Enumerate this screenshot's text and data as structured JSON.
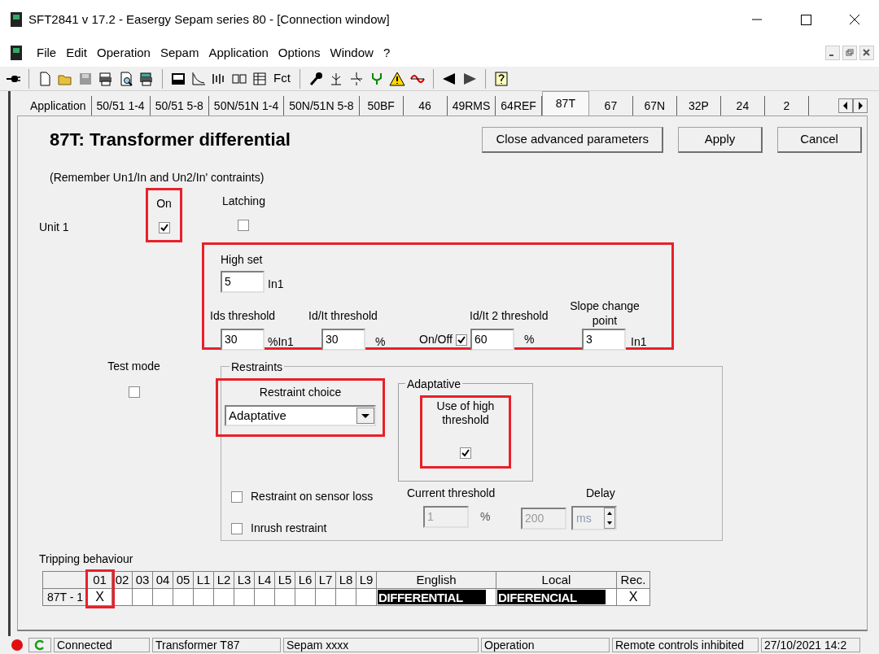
{
  "window": {
    "title": "SFT2841  v 17.2 - Easergy Sepam series 80 - [Connection window]"
  },
  "menu": [
    "File",
    "Edit",
    "Operation",
    "Sepam",
    "Application",
    "Options",
    "Window",
    "?"
  ],
  "toolbar": {
    "fct_label": "Fct"
  },
  "tabs": [
    {
      "label": "Application",
      "selected": false
    },
    {
      "label": "50/51 1-4",
      "selected": false
    },
    {
      "label": "50/51 5-8",
      "selected": false
    },
    {
      "label": "50N/51N 1-4",
      "selected": false
    },
    {
      "label": "50N/51N 5-8",
      "selected": false
    },
    {
      "label": "50BF",
      "selected": false
    },
    {
      "label": "46",
      "selected": false
    },
    {
      "label": "49RMS",
      "selected": false
    },
    {
      "label": "64REF",
      "selected": false
    },
    {
      "label": "87T",
      "selected": true
    },
    {
      "label": "67",
      "selected": false
    },
    {
      "label": "67N",
      "selected": false
    },
    {
      "label": "32P",
      "selected": false
    },
    {
      "label": "24",
      "selected": false
    },
    {
      "label": "2",
      "selected": false
    }
  ],
  "heading": "87T: Transformer differential",
  "buttons": [
    "Close advanced parameters",
    "Apply",
    "Cancel"
  ],
  "note": "(Remember Un1/In and Un2/In' contraints)",
  "unit": {
    "label": "Unit 1",
    "on_label": "On",
    "on": true,
    "on_highlighted": true,
    "latching_label": "Latching",
    "latching": false
  },
  "parameters": {
    "highlighted": true,
    "high_set": {
      "label": "High set",
      "value": "5",
      "unit": "In1"
    },
    "ids": {
      "label": "Ids threshold",
      "value": "30",
      "unit": "%In1"
    },
    "idit": {
      "label": "Id/It threshold",
      "value": "30",
      "unit": "%"
    },
    "idit2": {
      "label": "Id/It 2 threshold",
      "toggle_label": "On/Off",
      "enabled": true,
      "value": "60",
      "unit": "%"
    },
    "slope": {
      "label": "Slope change point",
      "value": "3",
      "unit": "In1"
    }
  },
  "test_mode": {
    "label": "Test mode",
    "checked": false
  },
  "restraints": {
    "title": "Restraints",
    "choice_label": "Restraint choice",
    "choice": "Adaptative",
    "choice_highlighted": true,
    "adaptive": {
      "title": "Adaptative",
      "label": "Use of high threshold",
      "checked": true,
      "highlighted": true
    },
    "sensor_loss": {
      "label": "Restraint on sensor loss",
      "checked": false
    },
    "inrush": {
      "label": "Inrush restraint",
      "checked": false
    },
    "current_threshold": {
      "label": "Current threshold",
      "value": "1",
      "unit": "%",
      "disabled": true
    },
    "delay": {
      "label": "Delay",
      "value": "200",
      "unit": "ms",
      "disabled": true
    }
  },
  "tripping": {
    "title": "Tripping behaviour",
    "columns": [
      {
        "label": "01",
        "highlighted": true
      },
      {
        "label": "02",
        "highlighted": false
      },
      {
        "label": "03",
        "highlighted": false
      },
      {
        "label": "04",
        "highlighted": false
      },
      {
        "label": "05",
        "highlighted": false
      },
      {
        "label": "L1",
        "highlighted": false
      },
      {
        "label": "L2",
        "highlighted": false
      },
      {
        "label": "L3",
        "highlighted": false
      },
      {
        "label": "L4",
        "highlighted": false
      },
      {
        "label": "L5",
        "highlighted": false
      },
      {
        "label": "L6",
        "highlighted": false
      },
      {
        "label": "L7",
        "highlighted": false
      },
      {
        "label": "L8",
        "highlighted": false
      },
      {
        "label": "L9",
        "highlighted": false
      }
    ],
    "english_label": "English",
    "local_label": "Local",
    "rec_label": "Rec.",
    "mark_symbol": "X",
    "rows": [
      {
        "name": "87T - 1",
        "marks": [
          true,
          false,
          false,
          false,
          false,
          false,
          false,
          false,
          false,
          false,
          false,
          false,
          false,
          false
        ],
        "english": "DIFFERENTIAL",
        "local": "DIFERENCIAL",
        "rec": {
          "checked": true,
          "symbol": "X"
        }
      }
    ]
  },
  "status_bar": [
    "Connected",
    "Transformer T87",
    "Sepam xxxx",
    "Operation",
    "Remote controls inhibited",
    "27/10/2021  14:2"
  ]
}
